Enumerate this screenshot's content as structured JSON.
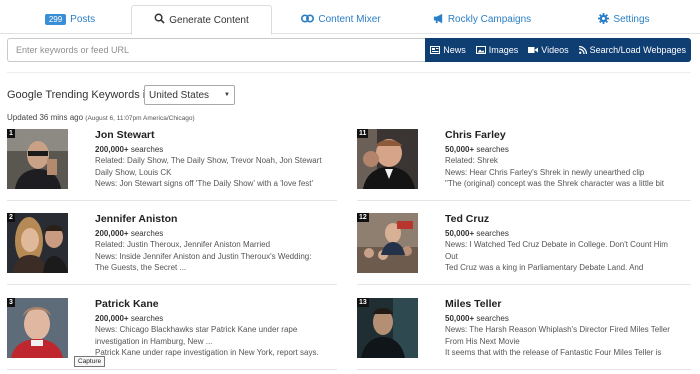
{
  "tabs": [
    {
      "badge": "299",
      "label": "Posts",
      "icon": "posts-badge"
    },
    {
      "label": "Generate Content",
      "icon": "search-icon"
    },
    {
      "label": "Content Mixer",
      "icon": "mixer-icon"
    },
    {
      "label": "Rockly Campaigns",
      "icon": "megaphone-icon"
    },
    {
      "label": "Settings",
      "icon": "gear-icon"
    }
  ],
  "search": {
    "placeholder": "Enter keywords or feed URL",
    "value": "",
    "buttons": [
      {
        "label": "News",
        "icon": "news-icon"
      },
      {
        "label": "Images",
        "icon": "image-icon"
      },
      {
        "label": "Videos",
        "icon": "video-icon"
      },
      {
        "label": "Search/Load Webpages",
        "icon": "rss-icon"
      }
    ]
  },
  "trending": {
    "label": "Google Trending Keywords in",
    "country": "United States",
    "updated": "Updated 36 mins ago",
    "updated_detail": "(August 6, 11:07pm America/Chicago)"
  },
  "items": [
    {
      "rank": "1",
      "name": "Jon Stewart",
      "searches_count": "200,000+",
      "searches_word": "searches",
      "lines": [
        "Related: Daily Show, The Daily Show, Trevor Noah, Jon Stewart",
        "Daily Show, Louis CK",
        "News: Jon Stewart signs off 'The Daily Show' with a 'love fest'"
      ]
    },
    {
      "rank": "11",
      "name": "Chris Farley",
      "searches_count": "50,000+",
      "searches_word": "searches",
      "lines": [
        "Related: Shrek",
        "News: Hear Chris Farley's Shrek in newly unearthed clip",
        "\"The (original) concept was the Shrek character was a little bit"
      ]
    },
    {
      "rank": "2",
      "name": "Jennifer Aniston",
      "searches_count": "200,000+",
      "searches_word": "searches",
      "lines": [
        "Related: Justin Theroux, Jennifer Aniston Married",
        "News: Inside Jennifer Aniston and Justin Theroux's Wedding:",
        "The Guests, the Secret ..."
      ]
    },
    {
      "rank": "12",
      "name": "Ted Cruz",
      "searches_count": "50,000+",
      "searches_word": "searches",
      "lines": [
        "News: I Watched Ted Cruz Debate in College. Don't Count Him",
        "Out",
        "Ted Cruz was a king in Parliamentary Debate Land. And"
      ]
    },
    {
      "rank": "3",
      "name": "Patrick Kane",
      "searches_count": "200,000+",
      "searches_word": "searches",
      "lines": [
        "News: Chicago Blackhawks star Patrick Kane under rape",
        "investigation in Hamburg, New ...",
        "Patrick Kane under rape investigation in New York, report says."
      ]
    },
    {
      "rank": "13",
      "name": "Miles Teller",
      "searches_count": "50,000+",
      "searches_word": "searches",
      "lines": [
        "News: The Harsh Reason Whiplash's Director Fired Miles Teller",
        "From His Next Movie",
        "It seems that with the release of Fantastic Four Miles Teller is"
      ]
    }
  ],
  "tooltip": "Capture",
  "colors": {
    "link": "#2a7ec5",
    "navy": "#0f3e73",
    "badge": "#3a8ed6"
  }
}
